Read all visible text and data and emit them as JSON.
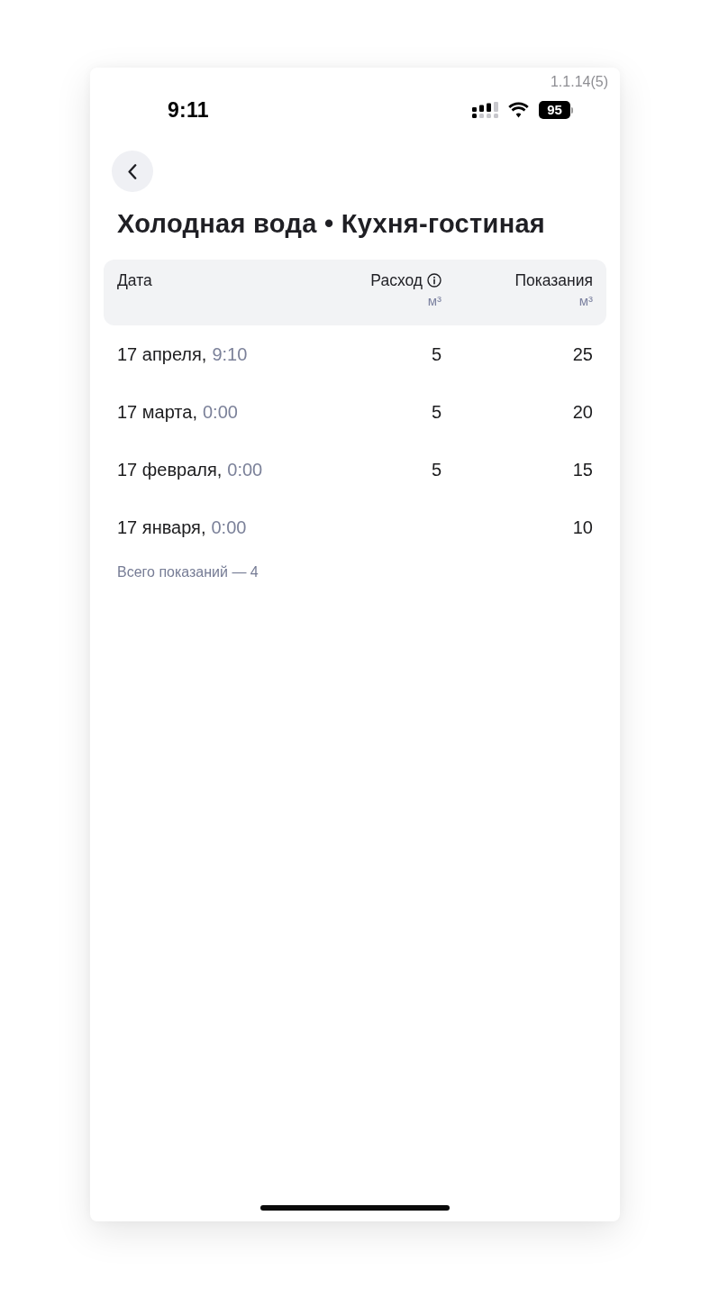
{
  "app_version": "1.1.14(5)",
  "status_bar": {
    "time": "9:11",
    "battery": "95"
  },
  "header": {
    "title": "Холодная вода • Кухня-гостиная"
  },
  "table": {
    "columns": [
      {
        "label": "Дата"
      },
      {
        "label": "Расход",
        "unit": "м³",
        "info": true
      },
      {
        "label": "Показания",
        "unit": "м³"
      }
    ],
    "rows": [
      {
        "date": "17 апреля,",
        "time": "9:10",
        "consumption": "5",
        "reading": "25"
      },
      {
        "date": "17 марта,",
        "time": "0:00",
        "consumption": "5",
        "reading": "20"
      },
      {
        "date": "17 февраля,",
        "time": "0:00",
        "consumption": "5",
        "reading": "15"
      },
      {
        "date": "17 января,",
        "time": "0:00",
        "reading": "10"
      }
    ]
  },
  "footer": {
    "total": "Всего показаний — 4"
  }
}
